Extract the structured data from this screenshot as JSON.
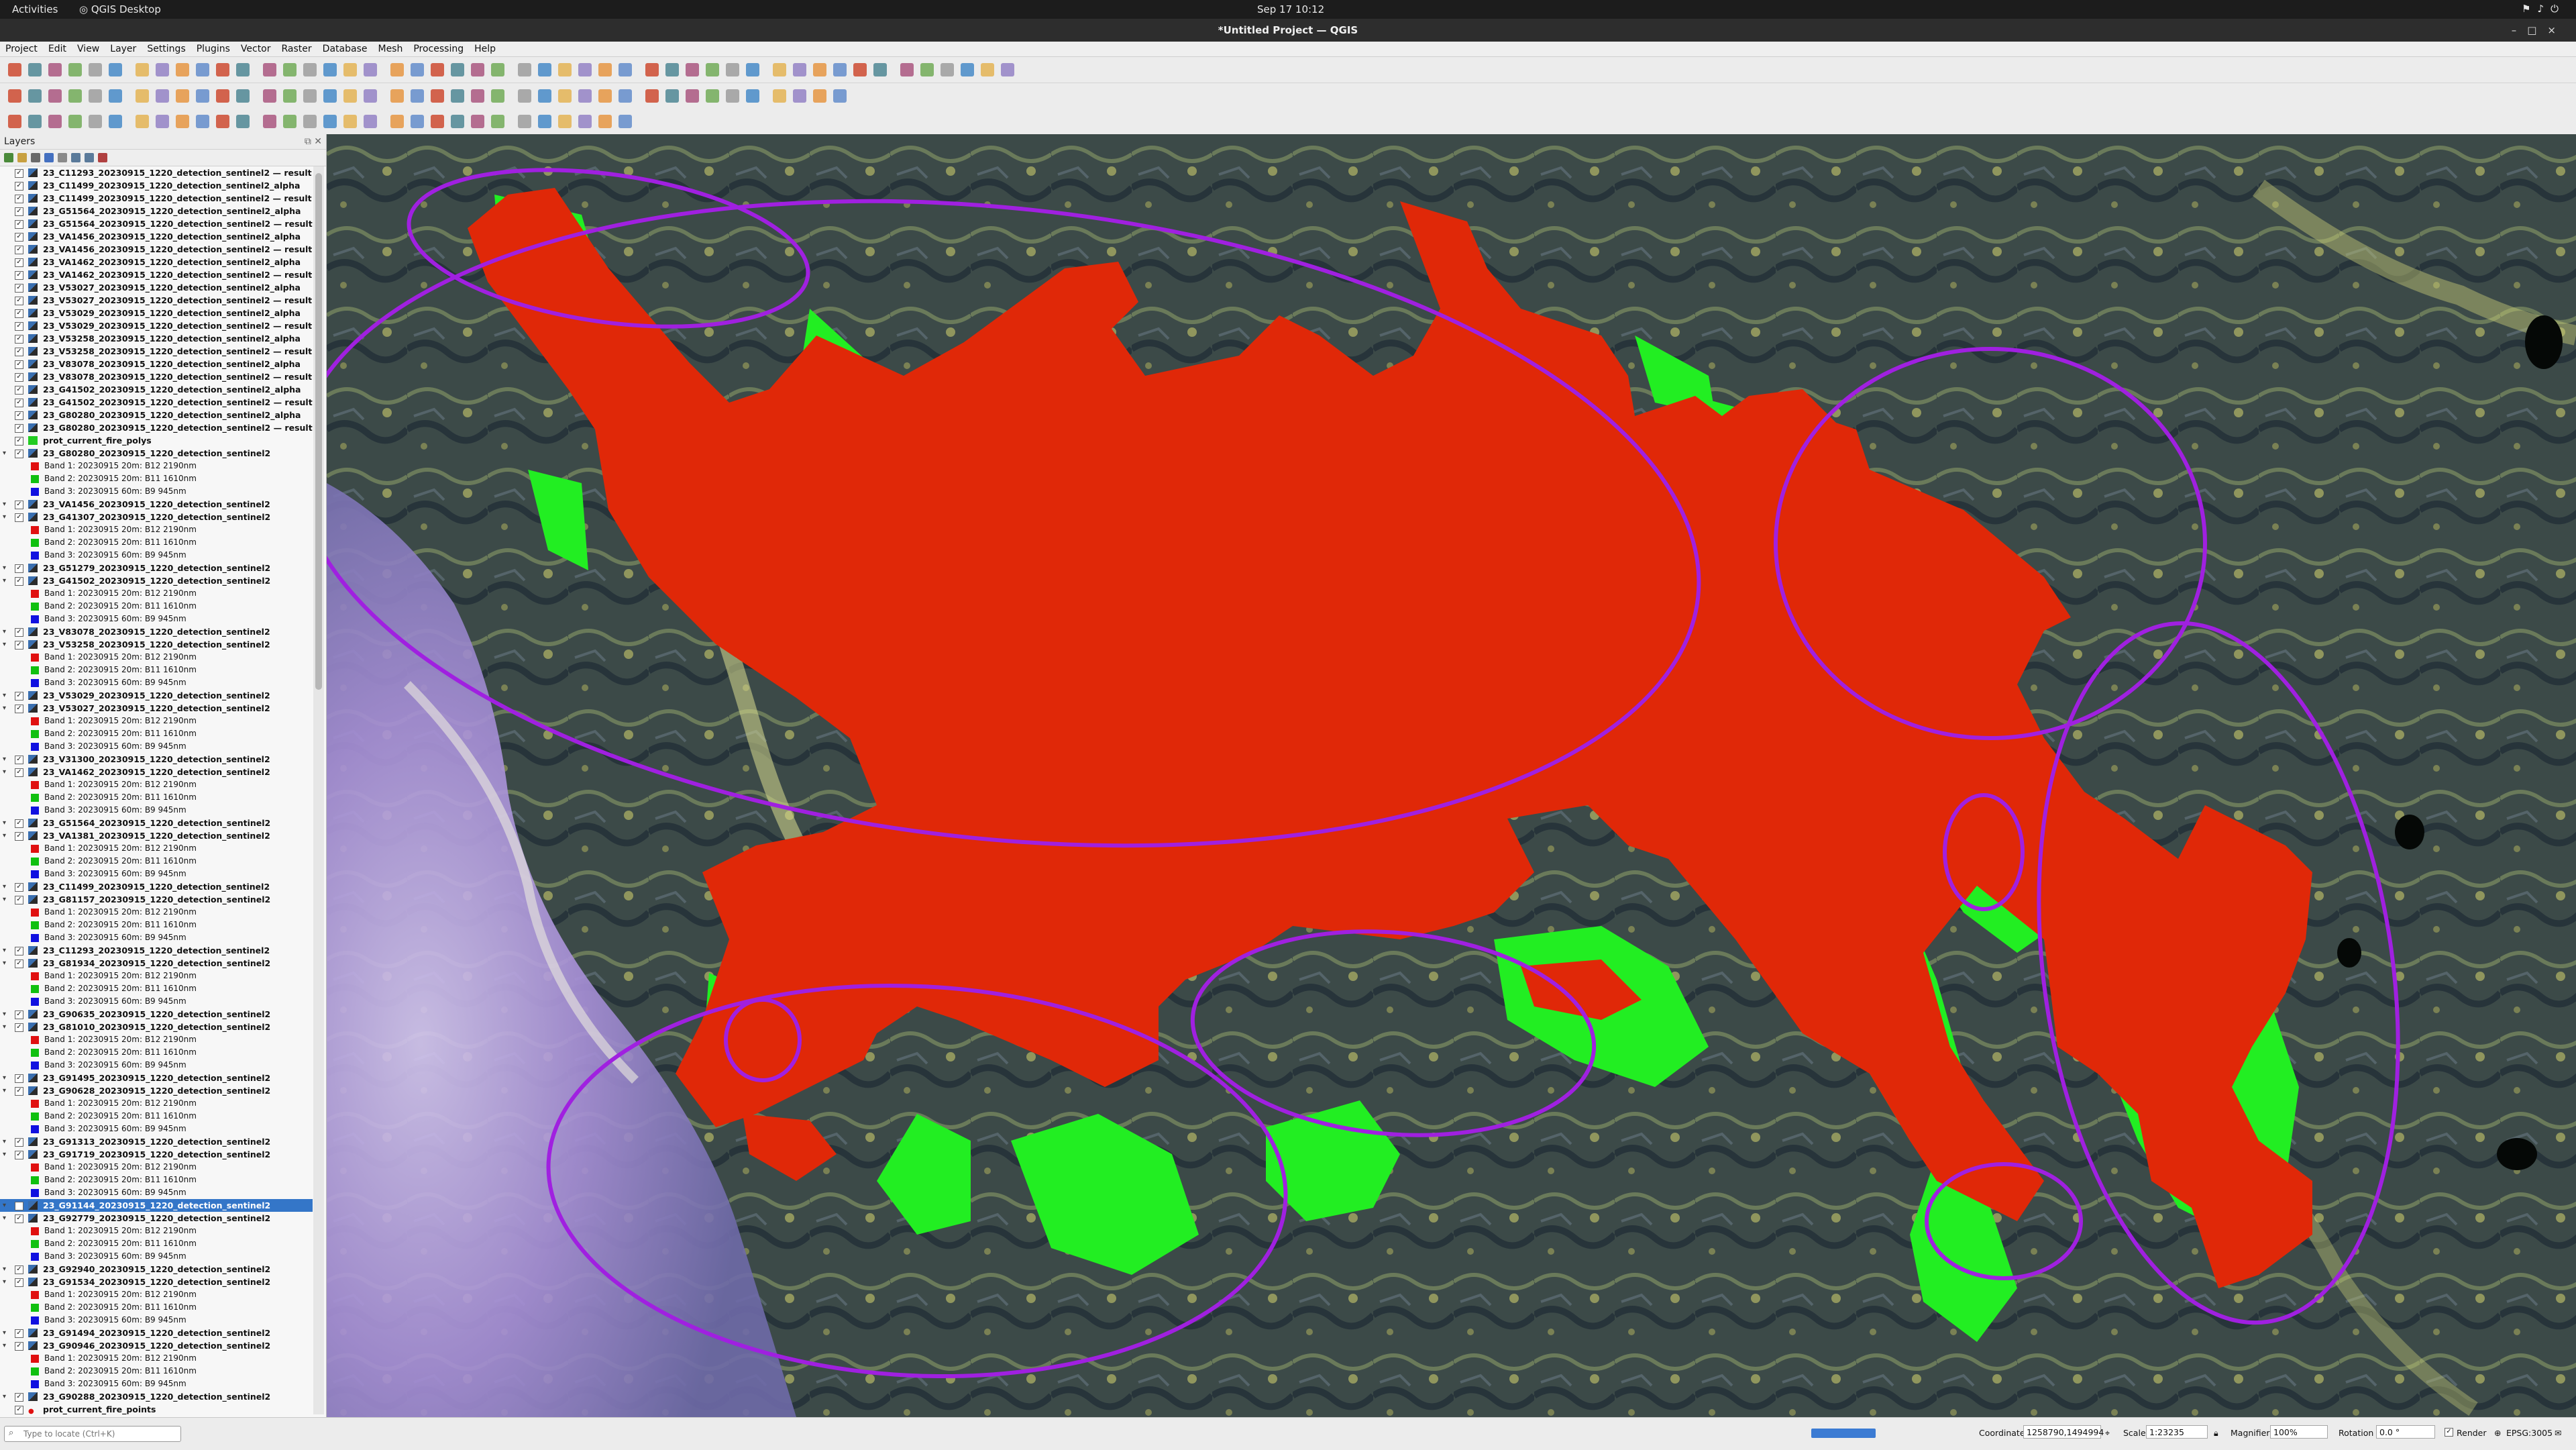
{
  "system": {
    "activities": "Activities",
    "app_name": "QGIS Desktop",
    "clock": "Sep 17  10:12"
  },
  "window": {
    "title": "*Untitled Project — QGIS"
  },
  "menu": [
    "Project",
    "Edit",
    "View",
    "Layer",
    "Settings",
    "Plugins",
    "Vector",
    "Raster",
    "Database",
    "Mesh",
    "Processing",
    "Help"
  ],
  "layers_panel": {
    "title": "Layers",
    "items": [
      {
        "kind": "raster",
        "name": "23_C11293_20230915_1220_detection_sentinel2 — result"
      },
      {
        "kind": "raster",
        "name": "23_C11499_20230915_1220_detection_sentinel2_alpha"
      },
      {
        "kind": "raster",
        "name": "23_C11499_20230915_1220_detection_sentinel2 — result"
      },
      {
        "kind": "raster",
        "name": "23_G51564_20230915_1220_detection_sentinel2_alpha"
      },
      {
        "kind": "raster",
        "name": "23_G51564_20230915_1220_detection_sentinel2 — result"
      },
      {
        "kind": "raster",
        "name": "23_VA1456_20230915_1220_detection_sentinel2_alpha"
      },
      {
        "kind": "raster",
        "name": "23_VA1456_20230915_1220_detection_sentinel2 — result"
      },
      {
        "kind": "raster",
        "name": "23_VA1462_20230915_1220_detection_sentinel2_alpha"
      },
      {
        "kind": "raster",
        "name": "23_VA1462_20230915_1220_detection_sentinel2 — result"
      },
      {
        "kind": "raster",
        "name": "23_V53027_20230915_1220_detection_sentinel2_alpha"
      },
      {
        "kind": "raster",
        "name": "23_V53027_20230915_1220_detection_sentinel2 — result"
      },
      {
        "kind": "raster",
        "name": "23_V53029_20230915_1220_detection_sentinel2_alpha"
      },
      {
        "kind": "raster",
        "name": "23_V53029_20230915_1220_detection_sentinel2 — result"
      },
      {
        "kind": "raster",
        "name": "23_V53258_20230915_1220_detection_sentinel2_alpha"
      },
      {
        "kind": "raster",
        "name": "23_V53258_20230915_1220_detection_sentinel2 — result"
      },
      {
        "kind": "raster",
        "name": "23_V83078_20230915_1220_detection_sentinel2_alpha"
      },
      {
        "kind": "raster",
        "name": "23_V83078_20230915_1220_detection_sentinel2 — result"
      },
      {
        "kind": "raster",
        "name": "23_G41502_20230915_1220_detection_sentinel2_alpha"
      },
      {
        "kind": "raster",
        "name": "23_G41502_20230915_1220_detection_sentinel2 — result"
      },
      {
        "kind": "raster",
        "name": "23_G80280_20230915_1220_detection_sentinel2_alpha"
      },
      {
        "kind": "raster",
        "name": "23_G80280_20230915_1220_detection_sentinel2 — result"
      },
      {
        "kind": "vector",
        "name": "prot_current_fire_polys"
      },
      {
        "kind": "group",
        "name": "23_G80280_20230915_1220_detection_sentinel2"
      },
      {
        "kind": "band",
        "color": "#e01010",
        "name": "Band 1: 20230915 20m: B12 2190nm"
      },
      {
        "kind": "band",
        "color": "#10c010",
        "name": "Band 2: 20230915 20m: B11 1610nm"
      },
      {
        "kind": "band",
        "color": "#1010e0",
        "name": "Band 3: 20230915 60m: B9 945nm"
      },
      {
        "kind": "group",
        "name": "23_VA1456_20230915_1220_detection_sentinel2"
      },
      {
        "kind": "group",
        "name": "23_G41307_20230915_1220_detection_sentinel2"
      },
      {
        "kind": "band",
        "color": "#e01010",
        "name": "Band 1: 20230915 20m: B12 2190nm"
      },
      {
        "kind": "band",
        "color": "#10c010",
        "name": "Band 2: 20230915 20m: B11 1610nm"
      },
      {
        "kind": "band",
        "color": "#1010e0",
        "name": "Band 3: 20230915 60m: B9 945nm"
      },
      {
        "kind": "group",
        "name": "23_G51279_20230915_1220_detection_sentinel2"
      },
      {
        "kind": "group",
        "name": "23_G41502_20230915_1220_detection_sentinel2"
      },
      {
        "kind": "band",
        "color": "#e01010",
        "name": "Band 1: 20230915 20m: B12 2190nm"
      },
      {
        "kind": "band",
        "color": "#10c010",
        "name": "Band 2: 20230915 20m: B11 1610nm"
      },
      {
        "kind": "band",
        "color": "#1010e0",
        "name": "Band 3: 20230915 60m: B9 945nm"
      },
      {
        "kind": "group",
        "name": "23_V83078_20230915_1220_detection_sentinel2"
      },
      {
        "kind": "group",
        "name": "23_V53258_20230915_1220_detection_sentinel2"
      },
      {
        "kind": "band",
        "color": "#e01010",
        "name": "Band 1: 20230915 20m: B12 2190nm"
      },
      {
        "kind": "band",
        "color": "#10c010",
        "name": "Band 2: 20230915 20m: B11 1610nm"
      },
      {
        "kind": "band",
        "color": "#1010e0",
        "name": "Band 3: 20230915 60m: B9 945nm"
      },
      {
        "kind": "group",
        "name": "23_V53029_20230915_1220_detection_sentinel2"
      },
      {
        "kind": "group",
        "name": "23_V53027_20230915_1220_detection_sentinel2"
      },
      {
        "kind": "band",
        "color": "#e01010",
        "name": "Band 1: 20230915 20m: B12 2190nm"
      },
      {
        "kind": "band",
        "color": "#10c010",
        "name": "Band 2: 20230915 20m: B11 1610nm"
      },
      {
        "kind": "band",
        "color": "#1010e0",
        "name": "Band 3: 20230915 60m: B9 945nm"
      },
      {
        "kind": "group",
        "name": "23_V31300_20230915_1220_detection_sentinel2"
      },
      {
        "kind": "group",
        "name": "23_VA1462_20230915_1220_detection_sentinel2"
      },
      {
        "kind": "band",
        "color": "#e01010",
        "name": "Band 1: 20230915 20m: B12 2190nm"
      },
      {
        "kind": "band",
        "color": "#10c010",
        "name": "Band 2: 20230915 20m: B11 1610nm"
      },
      {
        "kind": "band",
        "color": "#1010e0",
        "name": "Band 3: 20230915 60m: B9 945nm"
      },
      {
        "kind": "group",
        "name": "23_G51564_20230915_1220_detection_sentinel2"
      },
      {
        "kind": "group",
        "name": "23_VA1381_20230915_1220_detection_sentinel2"
      },
      {
        "kind": "band",
        "color": "#e01010",
        "name": "Band 1: 20230915 20m: B12 2190nm"
      },
      {
        "kind": "band",
        "color": "#10c010",
        "name": "Band 2: 20230915 20m: B11 1610nm"
      },
      {
        "kind": "band",
        "color": "#1010e0",
        "name": "Band 3: 20230915 60m: B9 945nm"
      },
      {
        "kind": "group",
        "name": "23_C11499_20230915_1220_detection_sentinel2"
      },
      {
        "kind": "group",
        "name": "23_G81157_20230915_1220_detection_sentinel2"
      },
      {
        "kind": "band",
        "color": "#e01010",
        "name": "Band 1: 20230915 20m: B12 2190nm"
      },
      {
        "kind": "band",
        "color": "#10c010",
        "name": "Band 2: 20230915 20m: B11 1610nm"
      },
      {
        "kind": "band",
        "color": "#1010e0",
        "name": "Band 3: 20230915 60m: B9 945nm"
      },
      {
        "kind": "group",
        "name": "23_C11293_20230915_1220_detection_sentinel2"
      },
      {
        "kind": "group",
        "name": "23_G81934_20230915_1220_detection_sentinel2"
      },
      {
        "kind": "band",
        "color": "#e01010",
        "name": "Band 1: 20230915 20m: B12 2190nm"
      },
      {
        "kind": "band",
        "color": "#10c010",
        "name": "Band 2: 20230915 20m: B11 1610nm"
      },
      {
        "kind": "band",
        "color": "#1010e0",
        "name": "Band 3: 20230915 60m: B9 945nm"
      },
      {
        "kind": "group",
        "name": "23_G90635_20230915_1220_detection_sentinel2"
      },
      {
        "kind": "group",
        "name": "23_G81010_20230915_1220_detection_sentinel2"
      },
      {
        "kind": "band",
        "color": "#e01010",
        "name": "Band 1: 20230915 20m: B12 2190nm"
      },
      {
        "kind": "band",
        "color": "#10c010",
        "name": "Band 2: 20230915 20m: B11 1610nm"
      },
      {
        "kind": "band",
        "color": "#1010e0",
        "name": "Band 3: 20230915 60m: B9 945nm"
      },
      {
        "kind": "group",
        "name": "23_G91495_20230915_1220_detection_sentinel2"
      },
      {
        "kind": "group",
        "name": "23_G90628_20230915_1220_detection_sentinel2"
      },
      {
        "kind": "band",
        "color": "#e01010",
        "name": "Band 1: 20230915 20m: B12 2190nm"
      },
      {
        "kind": "band",
        "color": "#10c010",
        "name": "Band 2: 20230915 20m: B11 1610nm"
      },
      {
        "kind": "band",
        "color": "#1010e0",
        "name": "Band 3: 20230915 60m: B9 945nm"
      },
      {
        "kind": "group",
        "name": "23_G91313_20230915_1220_detection_sentinel2"
      },
      {
        "kind": "group",
        "name": "23_G91719_20230915_1220_detection_sentinel2"
      },
      {
        "kind": "band",
        "color": "#e01010",
        "name": "Band 1: 20230915 20m: B12 2190nm"
      },
      {
        "kind": "band",
        "color": "#10c010",
        "name": "Band 2: 20230915 20m: B11 1610nm"
      },
      {
        "kind": "band",
        "color": "#1010e0",
        "name": "Band 3: 20230915 60m: B9 945nm"
      },
      {
        "kind": "group",
        "name": "23_G91144_20230915_1220_detection_sentinel2",
        "selected": true
      },
      {
        "kind": "group",
        "name": "23_G92779_20230915_1220_detection_sentinel2"
      },
      {
        "kind": "band",
        "color": "#e01010",
        "name": "Band 1: 20230915 20m: B12 2190nm"
      },
      {
        "kind": "band",
        "color": "#10c010",
        "name": "Band 2: 20230915 20m: B11 1610nm"
      },
      {
        "kind": "band",
        "color": "#1010e0",
        "name": "Band 3: 20230915 60m: B9 945nm"
      },
      {
        "kind": "group",
        "name": "23_G92940_20230915_1220_detection_sentinel2"
      },
      {
        "kind": "group",
        "name": "23_G91534_20230915_1220_detection_sentinel2"
      },
      {
        "kind": "band",
        "color": "#e01010",
        "name": "Band 1: 20230915 20m: B12 2190nm"
      },
      {
        "kind": "band",
        "color": "#10c010",
        "name": "Band 2: 20230915 20m: B11 1610nm"
      },
      {
        "kind": "band",
        "color": "#1010e0",
        "name": "Band 3: 20230915 60m: B9 945nm"
      },
      {
        "kind": "group",
        "name": "23_G91494_20230915_1220_detection_sentinel2"
      },
      {
        "kind": "group",
        "name": "23_G90946_20230915_1220_detection_sentinel2"
      },
      {
        "kind": "band",
        "color": "#e01010",
        "name": "Band 1: 20230915 20m: B12 2190nm"
      },
      {
        "kind": "band",
        "color": "#10c010",
        "name": "Band 2: 20230915 20m: B11 1610nm"
      },
      {
        "kind": "band",
        "color": "#1010e0",
        "name": "Band 3: 20230915 60m: B9 945nm"
      },
      {
        "kind": "group",
        "name": "23_G90288_20230915_1220_detection_sentinel2"
      },
      {
        "kind": "points",
        "name": "prot_current_fire_points"
      }
    ]
  },
  "map": {
    "fire_color": "#e02808",
    "green_color": "#22ee22",
    "ellipse_color": "#a020e0"
  },
  "status": {
    "locator_placeholder": "Type to locate (Ctrl+K)",
    "coordinate_label": "Coordinate",
    "coordinate_value": "1258790,1494994",
    "scale_label": "Scale",
    "scale_value": "1:23235",
    "magnifier_label": "Magnifier",
    "magnifier_value": "100%",
    "rotation_label": "Rotation",
    "rotation_value": "0.0 °",
    "render_label": "Render",
    "crs_label": "EPSG:3005"
  }
}
